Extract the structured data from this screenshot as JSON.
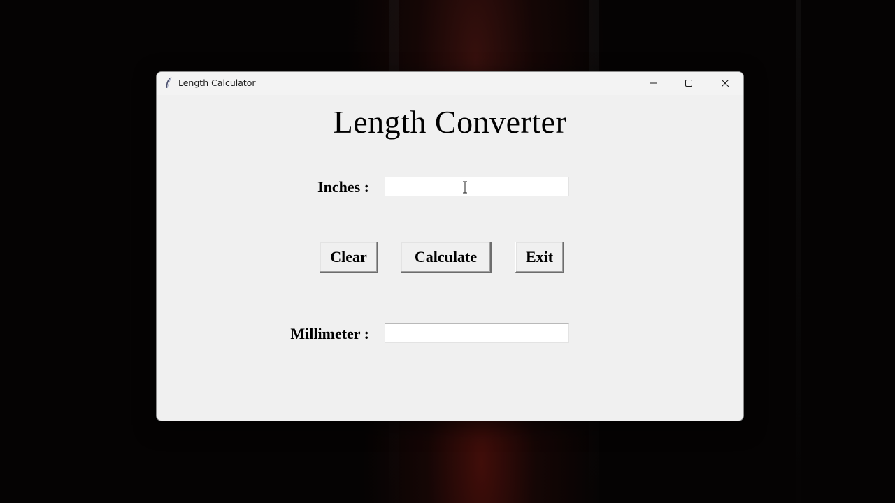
{
  "window": {
    "title": "Length Calculator",
    "controls": {
      "minimize_icon": "minimize-icon",
      "maximize_icon": "maximize-icon",
      "close_icon": "close-icon"
    },
    "app_icon": "feather-icon"
  },
  "main": {
    "heading": "Length Converter",
    "inches": {
      "label": "Inches :",
      "value": ""
    },
    "millimeter": {
      "label": "Millimeter :",
      "value": ""
    },
    "buttons": {
      "clear": "Clear",
      "calculate": "Calculate",
      "exit": "Exit"
    }
  },
  "colors": {
    "window_bg": "#f0f0f0",
    "titlebar_bg": "#f3f3f3",
    "desktop_bg": "#050303",
    "entry_bg": "#ffffff"
  }
}
